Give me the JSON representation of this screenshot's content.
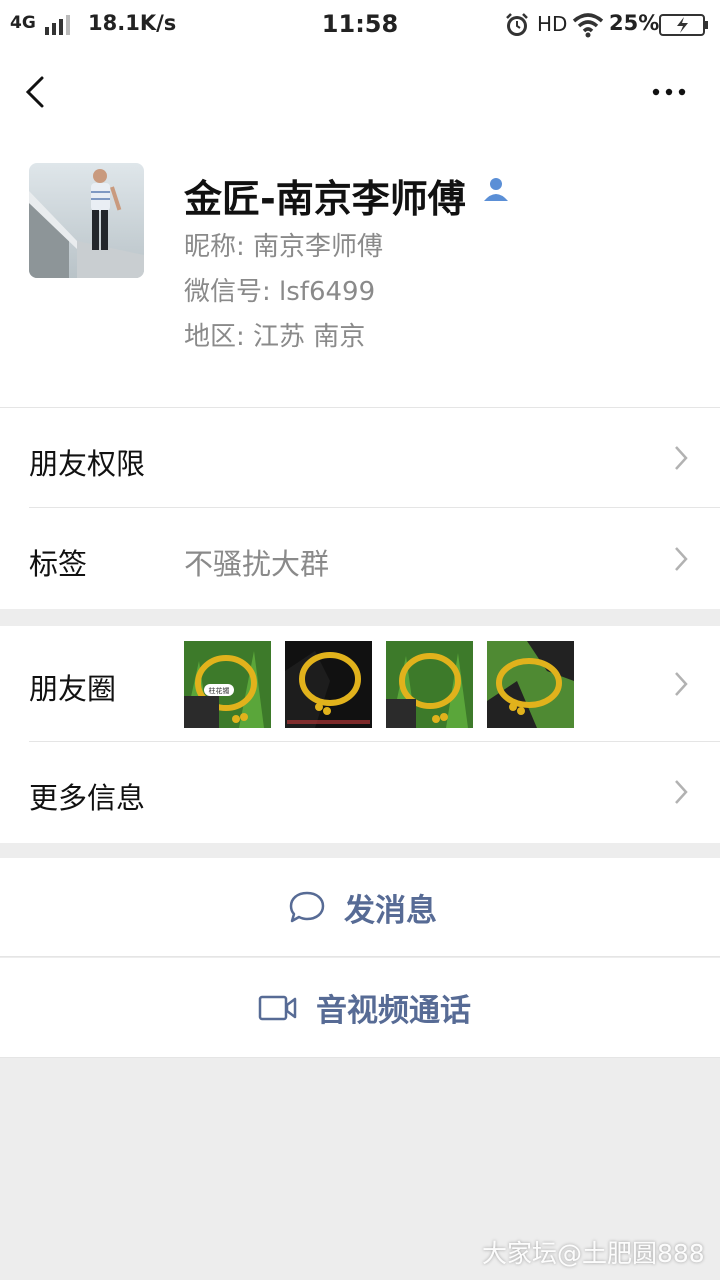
{
  "status_bar": {
    "network": "4G",
    "speed": "18.1K/s",
    "time": "11:58",
    "hd": "HD",
    "battery": "25%"
  },
  "navbar": {
    "back_icon": "chevron-left-icon",
    "more_icon": "more-dots-icon"
  },
  "profile": {
    "name": "金匠-南京李师傅",
    "nickname": "昵称:  南京李师傅",
    "wechat_id": "微信号:  lsf6499",
    "region": "地区:  江苏  南京",
    "badge_icon": "contact-person-icon"
  },
  "rows": {
    "permissions": "朋友权限",
    "tags_label": "标签",
    "tags_value": "不骚扰大群",
    "moments_label": "朋友圈",
    "more_info": "更多信息"
  },
  "moments_thumbs": [
    {
      "caption": "柱花镯"
    },
    {
      "caption": ""
    },
    {
      "caption": ""
    },
    {
      "caption": ""
    }
  ],
  "actions": {
    "message": "发消息",
    "call": "音视频通话",
    "accent": "#576b95"
  },
  "watermark": "大家坛@土肥圆888"
}
